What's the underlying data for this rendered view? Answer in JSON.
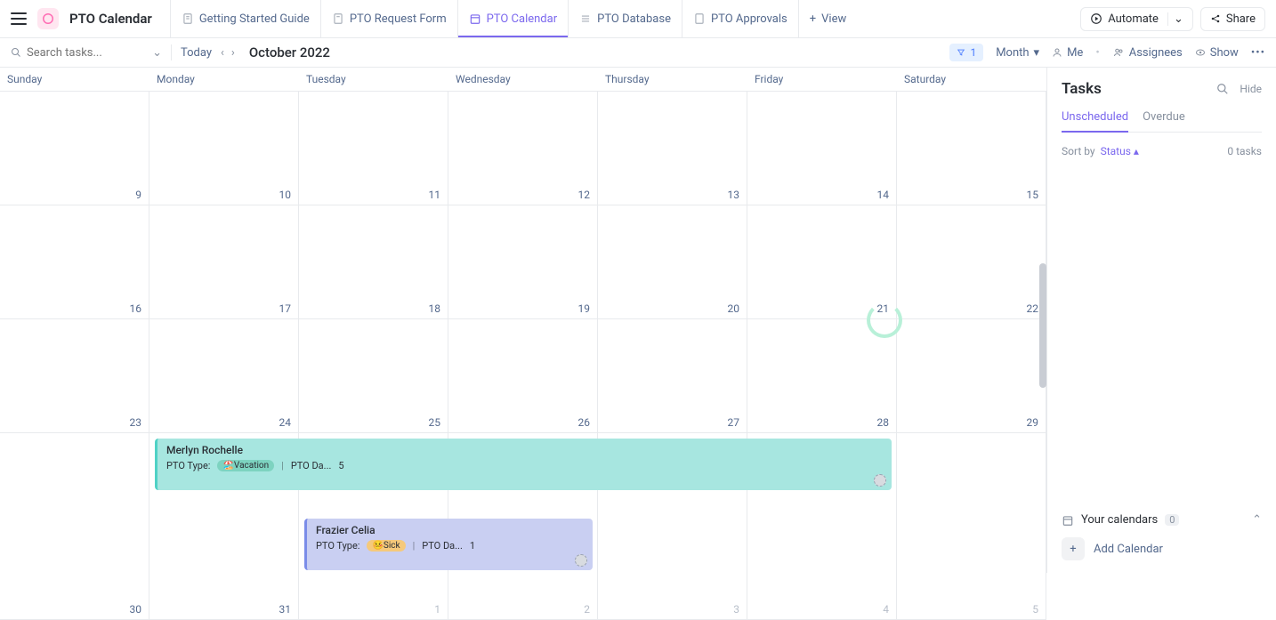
{
  "header": {
    "app_title": "PTO Calendar",
    "tabs": [
      {
        "label": "Getting Started Guide"
      },
      {
        "label": "PTO Request Form"
      },
      {
        "label": "PTO Calendar"
      },
      {
        "label": "PTO Database"
      },
      {
        "label": "PTO Approvals"
      }
    ],
    "view_label": "View",
    "automate_label": "Automate",
    "share_label": "Share"
  },
  "toolbar": {
    "search_placeholder": "Search tasks...",
    "today_label": "Today",
    "period": "October 2022",
    "filter_count": "1",
    "scale_label": "Month",
    "me_label": "Me",
    "assignees_label": "Assignees",
    "show_label": "Show"
  },
  "calendar": {
    "day_headers": [
      "Sunday",
      "Monday",
      "Tuesday",
      "Wednesday",
      "Thursday",
      "Friday",
      "Saturday"
    ],
    "weeks": [
      [
        {
          "n": "9"
        },
        {
          "n": "10"
        },
        {
          "n": "11"
        },
        {
          "n": "12"
        },
        {
          "n": "13"
        },
        {
          "n": "14"
        },
        {
          "n": "15"
        }
      ],
      [
        {
          "n": "16"
        },
        {
          "n": "17"
        },
        {
          "n": "18"
        },
        {
          "n": "19"
        },
        {
          "n": "20"
        },
        {
          "n": "21"
        },
        {
          "n": "22"
        }
      ],
      [
        {
          "n": "23"
        },
        {
          "n": "24"
        },
        {
          "n": "25"
        },
        {
          "n": "26"
        },
        {
          "n": "27"
        },
        {
          "n": "28"
        },
        {
          "n": "29"
        }
      ],
      [
        {
          "n": "30"
        },
        {
          "n": "31"
        },
        {
          "n": "1",
          "other": true
        },
        {
          "n": "2",
          "other": true
        },
        {
          "n": "3",
          "other": true
        },
        {
          "n": "4",
          "other": true
        },
        {
          "n": "5",
          "other": true
        }
      ]
    ],
    "events": {
      "vacation": {
        "name": "Merlyn Rochelle",
        "type_label": "PTO Type:",
        "tag": "🏖️Vacation",
        "days_label": "PTO Da...",
        "days_value": "5"
      },
      "sick": {
        "name": "Frazier Celia",
        "type_label": "PTO Type:",
        "tag": "🤒Sick",
        "days_label": "PTO Da...",
        "days_value": "1"
      }
    }
  },
  "sidebar": {
    "title": "Tasks",
    "hide_label": "Hide",
    "tabs": {
      "unscheduled": "Unscheduled",
      "overdue": "Overdue"
    },
    "sort_label": "Sort by",
    "sort_value": "Status",
    "task_count": "0 tasks",
    "your_calendars_label": "Your calendars",
    "your_calendars_count": "0",
    "add_calendar_label": "Add Calendar"
  }
}
